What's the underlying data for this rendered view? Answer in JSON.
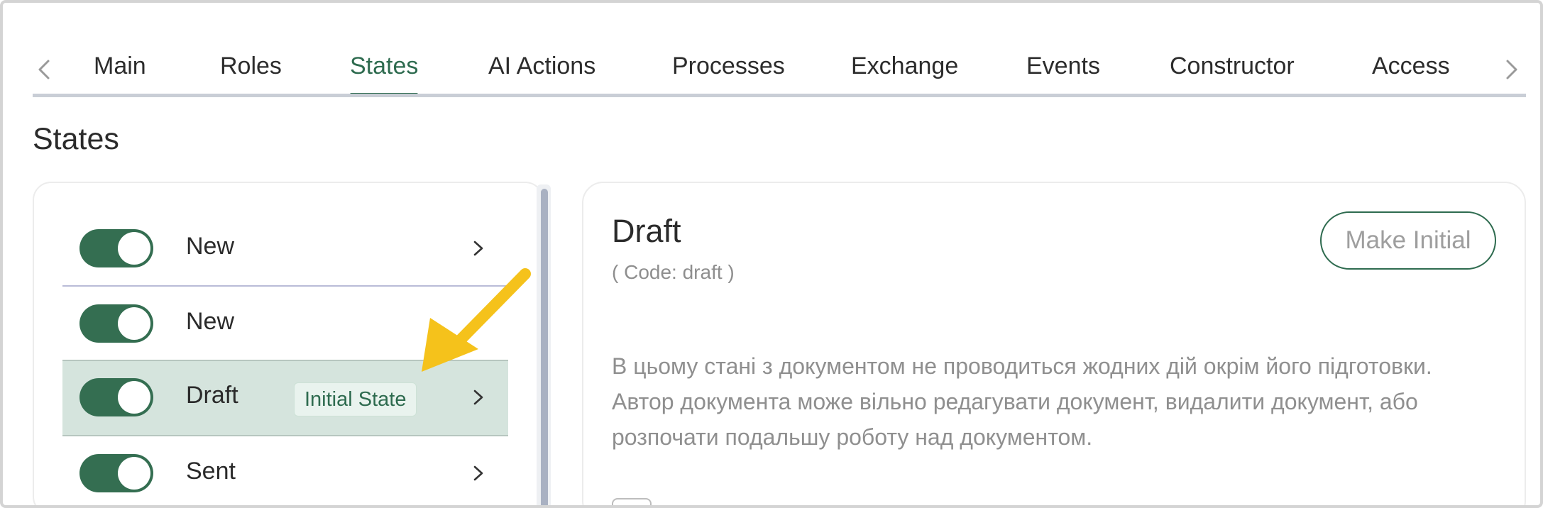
{
  "tabs": {
    "items": [
      {
        "label": "Main"
      },
      {
        "label": "Roles"
      },
      {
        "label": "States",
        "active": true
      },
      {
        "label": "AI Actions"
      },
      {
        "label": "Processes"
      },
      {
        "label": "Exchange"
      },
      {
        "label": "Events"
      },
      {
        "label": "Constructor"
      },
      {
        "label": "Access"
      }
    ],
    "prev_icon": "chevron-left-icon",
    "next_icon": "chevron-right-icon"
  },
  "page": {
    "title": "States"
  },
  "states_list": {
    "items": [
      {
        "label": "New",
        "enabled": true,
        "has_chevron": true
      },
      {
        "label": "New",
        "enabled": true,
        "has_chevron": false
      },
      {
        "label": "Draft",
        "enabled": true,
        "has_chevron": true,
        "selected": true,
        "badge": "Initial State"
      },
      {
        "label": "Sent",
        "enabled": true,
        "has_chevron": true
      }
    ]
  },
  "detail": {
    "title": "Draft",
    "code": "( Code: draft )",
    "make_initial_label": "Make Initial",
    "description": "В цьому стані з документом не проводиться жодних дій окрім його підготовки. Автор документа може вільно редагувати документ, видалити документ, або розпочати подальшу роботу над документом."
  },
  "colors": {
    "accent": "#2e6b4f",
    "selected_row": "#d5e4dd",
    "annotation_arrow": "#f5c21b"
  }
}
